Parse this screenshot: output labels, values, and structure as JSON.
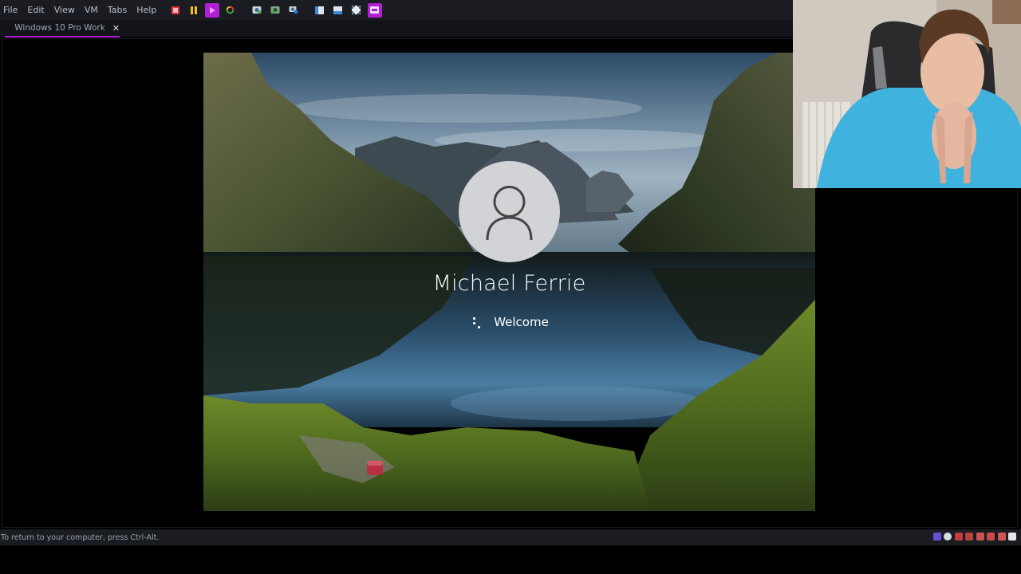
{
  "menubar": {
    "items": [
      "File",
      "Edit",
      "View",
      "VM",
      "Tabs",
      "Help"
    ]
  },
  "toolbar": {
    "buttons": [
      {
        "icon": "power-off-icon",
        "color": "#e0313c"
      },
      {
        "icon": "pause-icon",
        "color": "#f2c318"
      },
      {
        "icon": "play-icon",
        "color": "#b21ed6",
        "active": true
      },
      {
        "icon": "restart-icon",
        "color": "#3fae3f"
      },
      {
        "icon": "snapshot-icon"
      },
      {
        "icon": "revert-snapshot-icon"
      },
      {
        "icon": "snapshot-manager-icon"
      },
      {
        "icon": "show-library-icon"
      },
      {
        "icon": "thumbnail-bar-icon"
      },
      {
        "icon": "full-screen-icon"
      },
      {
        "icon": "unity-icon",
        "active": true
      }
    ]
  },
  "tabs": [
    {
      "label": "Windows 10 Pro Work",
      "icon": "vm-icon",
      "close": "✕"
    }
  ],
  "lockscreen": {
    "user_name": "Michael Ferrie",
    "status_text": "Welcome",
    "avatar_icon": "user-avatar-icon"
  },
  "statusbar": {
    "hint": "To return to your computer, press Ctrl-Alt."
  },
  "colors": {
    "accent": "#b21ed6",
    "chrome": "#1a1c22"
  }
}
